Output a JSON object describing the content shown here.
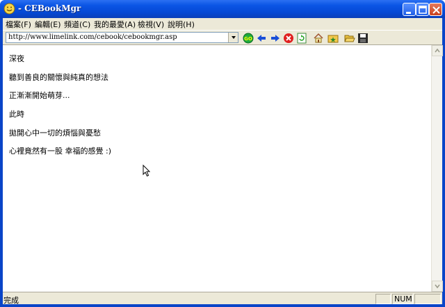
{
  "window": {
    "title": "- CEBookMgr"
  },
  "menu": {
    "items": [
      {
        "label": "檔案(F)"
      },
      {
        "label": "編輯(E)"
      },
      {
        "label": "頻道(C)"
      },
      {
        "label": "我的最愛(A)"
      },
      {
        "label": "檢視(V)"
      },
      {
        "label": "說明(H)"
      }
    ]
  },
  "toolbar": {
    "address": "http://www.limelink.com/cebook/cebookmgr.asp",
    "icons": [
      "go-icon",
      "back-icon",
      "forward-icon",
      "stop-icon",
      "refresh-icon",
      "home-icon",
      "favorites-icon",
      "open-icon",
      "save-icon"
    ]
  },
  "content": {
    "lines": [
      "深夜",
      "聽到善良的關懷與純真的想法",
      "正漸漸開始萌芽...",
      "此時",
      "拋開心中一切的煩惱與憂愁",
      "心裡竟然有一股 幸福的感覺 :)"
    ]
  },
  "status": {
    "text": "完成",
    "num_label": "NUM"
  }
}
